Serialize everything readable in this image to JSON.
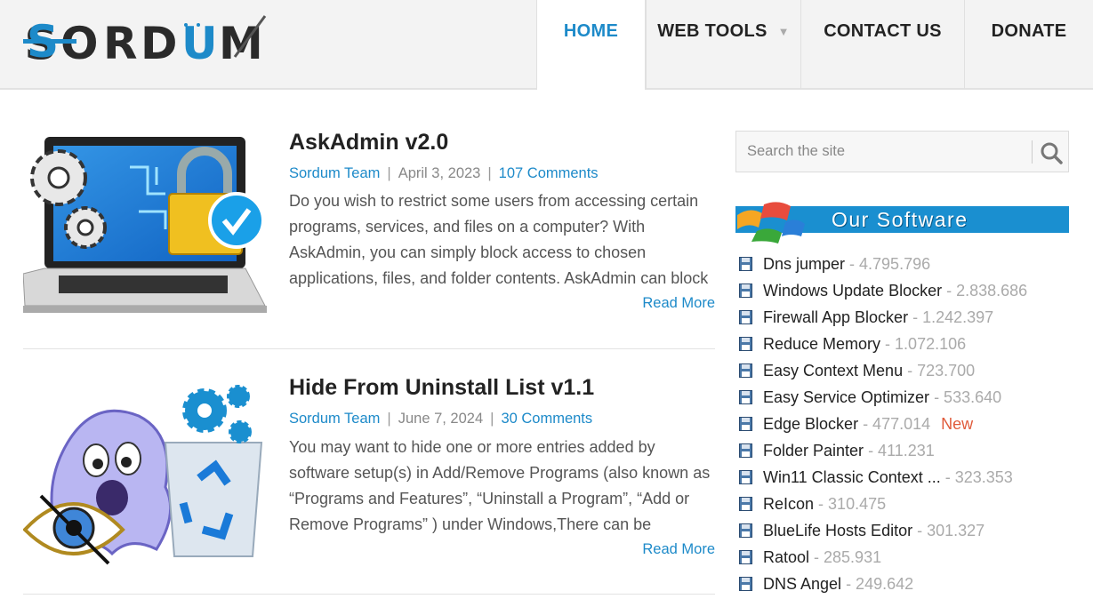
{
  "site": {
    "logo_text": "Sordum"
  },
  "nav": {
    "items": [
      {
        "label": "HOME",
        "active": true
      },
      {
        "label": "WEB TOOLS",
        "has_dropdown": true
      },
      {
        "label": "CONTACT US"
      },
      {
        "label": "DONATE"
      }
    ]
  },
  "posts": [
    {
      "title": "AskAdmin v2.0",
      "author": "Sordum Team",
      "date": "April 3, 2023",
      "comments": "107 Comments",
      "excerpt": "Do you wish to restrict some users from accessing certain programs, services, and files on a computer? With AskAdmin, you can simply block access to chosen applications, files, and folder contents. AskAdmin can block",
      "read_more": "Read More"
    },
    {
      "title": "Hide From Uninstall List v1.1",
      "author": "Sordum Team",
      "date": "June 7, 2024",
      "comments": "30 Comments",
      "excerpt": "You may want to hide one or more entries added by software setup(s) in Add/Remove Programs (also known as “Programs and Features”, “Uninstall a Program”, “Add or Remove Programs” ) under Windows,There can be",
      "read_more": "Read More"
    }
  ],
  "sidebar": {
    "search_placeholder": "Search the site",
    "software_title": "Our Software",
    "software": [
      {
        "name": "Dns jumper",
        "count": "- 4.795.796"
      },
      {
        "name": "Windows Update Blocker",
        "count": "- 2.838.686"
      },
      {
        "name": "Firewall App Blocker",
        "count": "- 1.242.397"
      },
      {
        "name": "Reduce Memory",
        "count": "- 1.072.106"
      },
      {
        "name": "Easy Context Menu",
        "count": "- 723.700"
      },
      {
        "name": "Easy Service Optimizer",
        "count": "- 533.640"
      },
      {
        "name": "Edge Blocker",
        "count": "- 477.014",
        "badge": "New"
      },
      {
        "name": "Folder Painter",
        "count": "- 411.231"
      },
      {
        "name": "Win11 Classic Context ...",
        "count": "- 323.353"
      },
      {
        "name": "ReIcon",
        "count": "- 310.475"
      },
      {
        "name": "BlueLife Hosts Editor",
        "count": "- 301.327"
      },
      {
        "name": "Ratool",
        "count": "- 285.931"
      },
      {
        "name": "DNS Angel",
        "count": "- 249.642"
      }
    ]
  },
  "colors": {
    "accent": "#1d8ac9",
    "banner": "#1a8fd0",
    "new_badge": "#e05a3a"
  }
}
